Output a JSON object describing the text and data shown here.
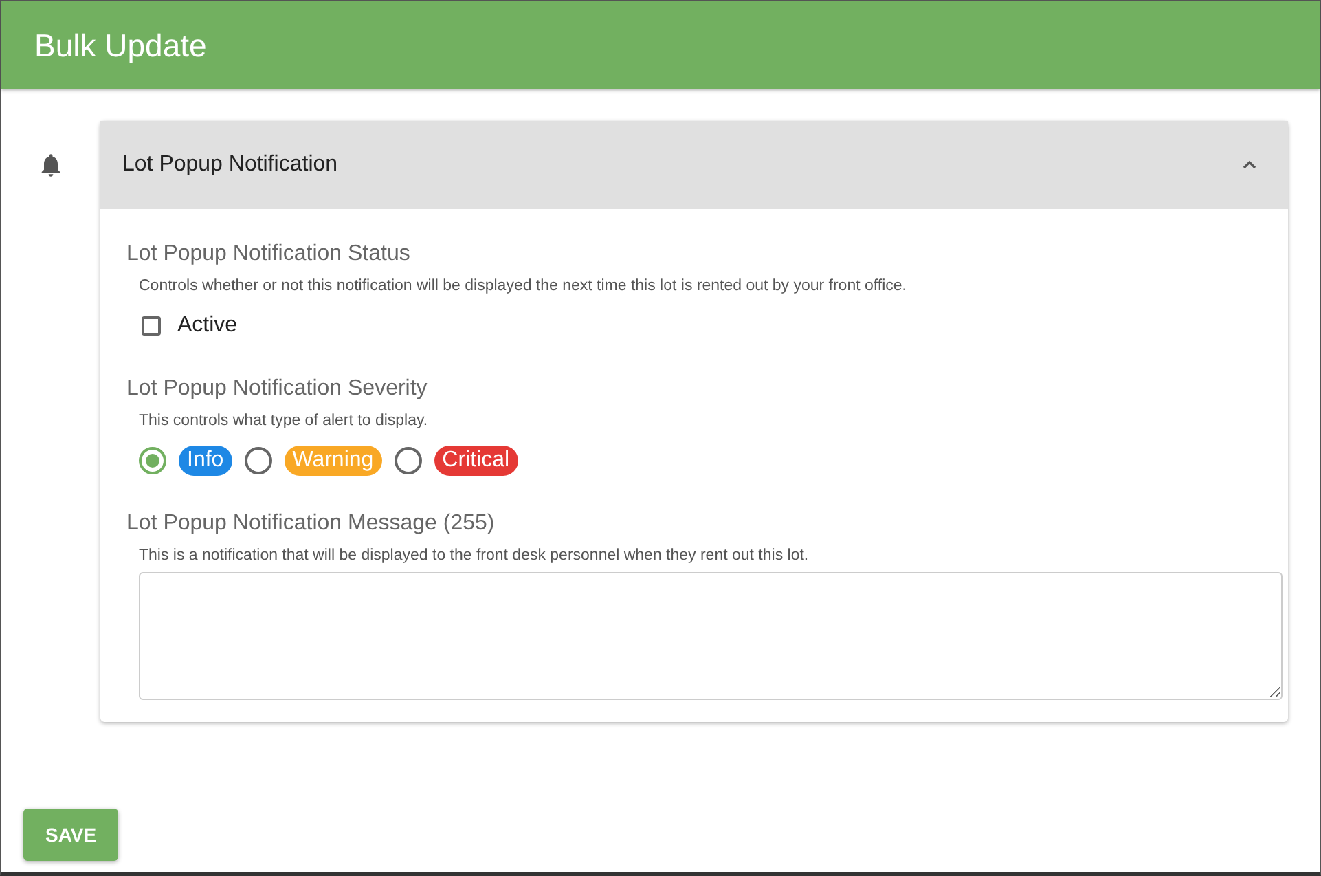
{
  "window": {
    "title": "Bulk Update"
  },
  "panel": {
    "title": "Lot Popup Notification",
    "expanded": true,
    "status": {
      "title": "Lot Popup Notification Status",
      "description": "Controls whether or not this notification will be displayed the next time this lot is rented out by your front office.",
      "checkbox": {
        "label": "Active",
        "checked": false
      }
    },
    "severity": {
      "title": "Lot Popup Notification Severity",
      "description": "This controls what type of alert to display.",
      "options": [
        {
          "label": "Info",
          "color": "#1e88e5",
          "selected": true
        },
        {
          "label": "Warning",
          "color": "#f9a825",
          "selected": false
        },
        {
          "label": "Critical",
          "color": "#e53935",
          "selected": false
        }
      ]
    },
    "message": {
      "title": "Lot Popup Notification Message (255)",
      "description": "This is a notification that will be displayed to the front desk personnel when they rent out this lot."
    }
  },
  "buttons": [
    {
      "label": "SAVE"
    }
  ]
}
